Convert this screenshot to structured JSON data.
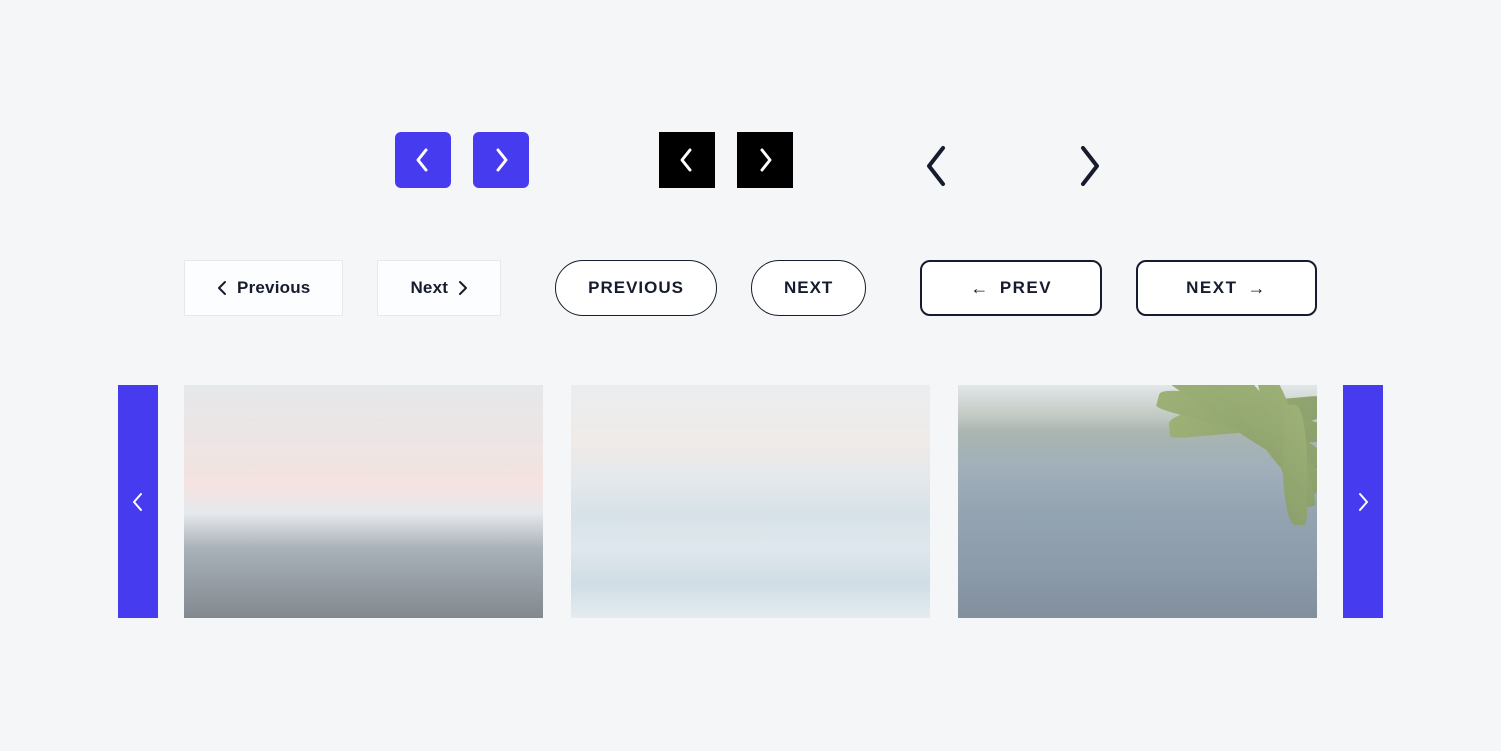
{
  "colors": {
    "accent": "#473bf0",
    "black": "#000000",
    "text": "#161c2d",
    "border_light": "#e6e8eb",
    "bg": "#f5f6f7"
  },
  "row2": {
    "pair1": {
      "prev": "Previous",
      "next": "Next"
    },
    "pair2": {
      "prev": "PREVIOUS",
      "next": "NEXT"
    },
    "pair3": {
      "prev": "PREV",
      "next": "NEXT"
    }
  },
  "carousel": {
    "slides": [
      "mountain-sunset",
      "ocean-waves",
      "lake-palm"
    ]
  }
}
